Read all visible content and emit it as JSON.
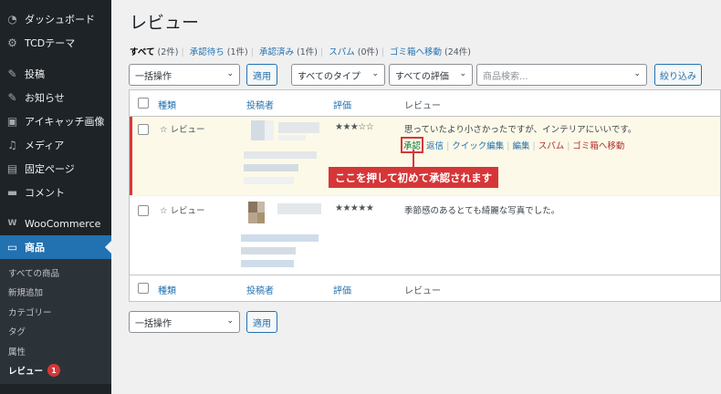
{
  "sidebar": {
    "items": [
      {
        "label": "ダッシュボード",
        "icon": "dashboard-icon",
        "glyph": "◔"
      },
      {
        "label": "TCDテーマ",
        "icon": "gear-icon",
        "glyph": "⚙"
      },
      {
        "label": "投稿",
        "icon": "pin-icon",
        "glyph": "✎"
      },
      {
        "label": "お知らせ",
        "icon": "pin-icon",
        "glyph": "✎"
      },
      {
        "label": "アイキャッチ画像",
        "icon": "image-icon",
        "glyph": "▣"
      },
      {
        "label": "メディア",
        "icon": "media-icon",
        "glyph": "♫"
      },
      {
        "label": "固定ページ",
        "icon": "page-icon",
        "glyph": "▤"
      },
      {
        "label": "コメント",
        "icon": "comment-icon",
        "glyph": "▬"
      },
      {
        "label": "WooCommerce",
        "icon": "woocommerce-icon",
        "glyph": "W"
      },
      {
        "label": "商品",
        "icon": "product-icon",
        "glyph": "▭"
      }
    ],
    "submenu": [
      {
        "label": "すべての商品"
      },
      {
        "label": "新規追加"
      },
      {
        "label": "カテゴリー"
      },
      {
        "label": "タグ"
      },
      {
        "label": "属性"
      },
      {
        "label": "レビュー",
        "badge": "1"
      }
    ]
  },
  "page": {
    "title": "レビュー",
    "filters": [
      {
        "label": "すべて",
        "count": "(2件)"
      },
      {
        "label": "承認待ち",
        "count": "(1件)"
      },
      {
        "label": "承認済み",
        "count": "(1件)"
      },
      {
        "label": "スパム",
        "count": "(0件)"
      },
      {
        "label": "ゴミ箱へ移動",
        "count": "(24件)"
      }
    ],
    "bulk_action": "一括操作",
    "apply": "適用",
    "type_filter": "すべてのタイプ",
    "rating_filter": "すべての評価",
    "search_placeholder": "商品検索...",
    "filter_button": "絞り込み"
  },
  "table": {
    "headers": {
      "type": "種類",
      "author": "投稿者",
      "rating": "評価",
      "review": "レビュー"
    },
    "rows": [
      {
        "type": "☆ レビュー",
        "stars": "★★★☆☆",
        "rating": 3,
        "text": "思っていたより小さかったですが、インテリアにいいです。",
        "actions": {
          "approve": "承認",
          "reply": "返信",
          "quick_edit": "クイック編集",
          "edit": "編集",
          "spam": "スパム",
          "trash": "ゴミ箱へ移動"
        }
      },
      {
        "type": "☆ レビュー",
        "stars": "★★★★★",
        "rating": 5,
        "text": "季節感のあるとても綺麗な写真でした。"
      }
    ]
  },
  "callout": "ここを押して初めて承認されます",
  "colors": {
    "sidebar": "#1d2327",
    "accent": "#2271b1",
    "highlight": "#d63638",
    "pending_bg": "#fcf9e8"
  }
}
